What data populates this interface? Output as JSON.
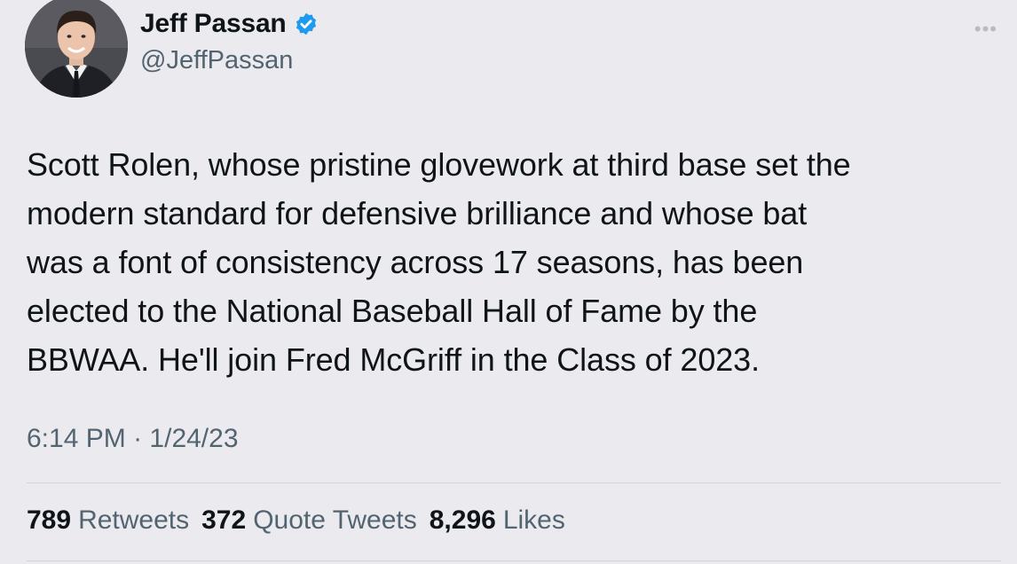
{
  "author": {
    "display_name": "Jeff Passan",
    "handle": "@JeffPassan",
    "verified_icon": "verified-badge-icon",
    "accent_color": "#1d9bf0"
  },
  "menu": {
    "more_icon": "more-options-icon"
  },
  "tweet": {
    "text": "Scott Rolen, whose pristine glovework at third base set the\nmodern standard for defensive brilliance and whose bat\nwas a font of consistency across 17 seasons, has been\nelected to the National Baseball Hall of Fame by the\nBBWAA. He'll join Fred McGriff in the Class of 2023.",
    "time": "6:14 PM",
    "separator": "·",
    "date": "1/24/23"
  },
  "stats": {
    "retweets_count": "789",
    "retweets_label": "Retweets",
    "quotes_count": "372",
    "quotes_label": "Quote Tweets",
    "likes_count": "8,296",
    "likes_label": "Likes"
  }
}
